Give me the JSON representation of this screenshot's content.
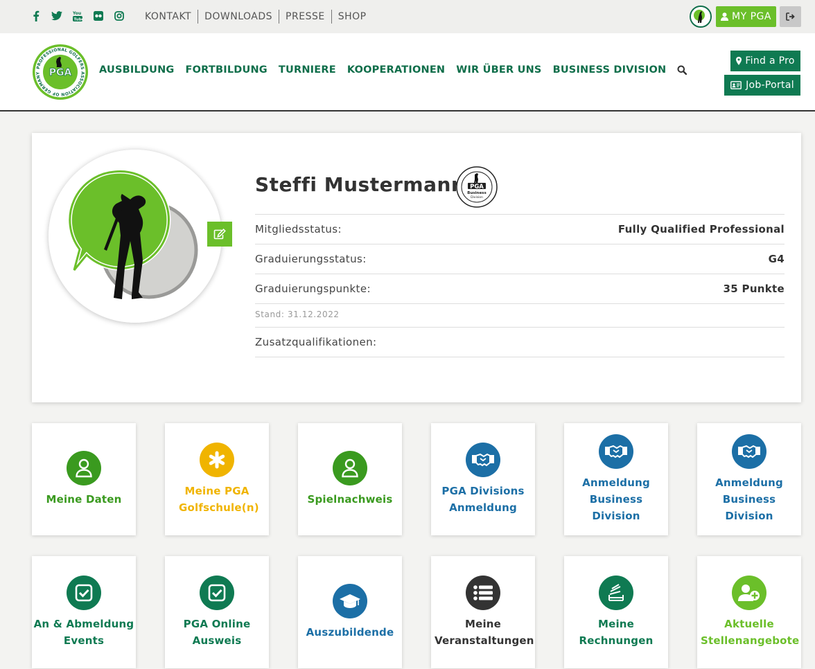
{
  "topbar": {
    "social": [
      "facebook-icon",
      "twitter-icon",
      "youtube-icon",
      "flickr-icon",
      "instagram-icon"
    ],
    "links": [
      "KONTAKT",
      "DOWNLOADS",
      "PRESSE",
      "SHOP"
    ],
    "mypga_label": "MY PGA"
  },
  "header": {
    "logo_text": "PGA",
    "logo_ring_text": "PROFESSIONAL GOLFERS ASSOCIATION OF GERMANY",
    "nav": [
      "AUSBILDUNG",
      "FORTBILDUNG",
      "TURNIERE",
      "KOOPERATIONEN",
      "WIR ÜBER UNS",
      "BUSINESS DIVISION"
    ],
    "find_pro_label": "Find a Pro",
    "job_portal_label": "Job-Portal"
  },
  "profile": {
    "name": "Steffi Mustermann",
    "badge_text": "PGA Business Division",
    "rows": [
      {
        "key": "Mitgliedsstatus:",
        "value": "Fully Qualified Professional"
      },
      {
        "key": "Graduierungsstatus:",
        "value": "G4"
      },
      {
        "key": "Graduierungspunkte:",
        "value": "35 Punkte"
      }
    ],
    "stand": "Stand: 31.12.2022",
    "zusatz_label": "Zusatzqualifikationen:"
  },
  "colors": {
    "green": "#6bbf2a",
    "dark_green": "#0f7a52",
    "blue": "#1c6fa6",
    "yellow": "#f0b400"
  },
  "tiles": [
    {
      "label": "Meine Daten",
      "icon": "user-icon"
    },
    {
      "label": "Meine PGA Golfschule(n)",
      "icon": "asterisk-icon"
    },
    {
      "label": "Spielnachweis",
      "icon": "user-icon"
    },
    {
      "label": "PGA Divisions Anmeldung",
      "icon": "handshake-icon"
    },
    {
      "label": "Anmeldung Business Division",
      "icon": "handshake-icon"
    },
    {
      "label": "Anmeldung Business Division",
      "icon": "handshake-icon"
    },
    {
      "label": "An & Abmeldung Events",
      "icon": "checkbox-icon"
    },
    {
      "label": "PGA Online Ausweis",
      "icon": "checkbox-icon"
    },
    {
      "label": "Auszubildende",
      "icon": "graduation-cap-icon"
    },
    {
      "label": "Meine Veranstaltungen",
      "icon": "list-icon"
    },
    {
      "label": "Meine Rechnungen",
      "icon": "stack-icon"
    },
    {
      "label": "Aktuelle Stellenangebote",
      "icon": "user-plus-icon"
    }
  ]
}
